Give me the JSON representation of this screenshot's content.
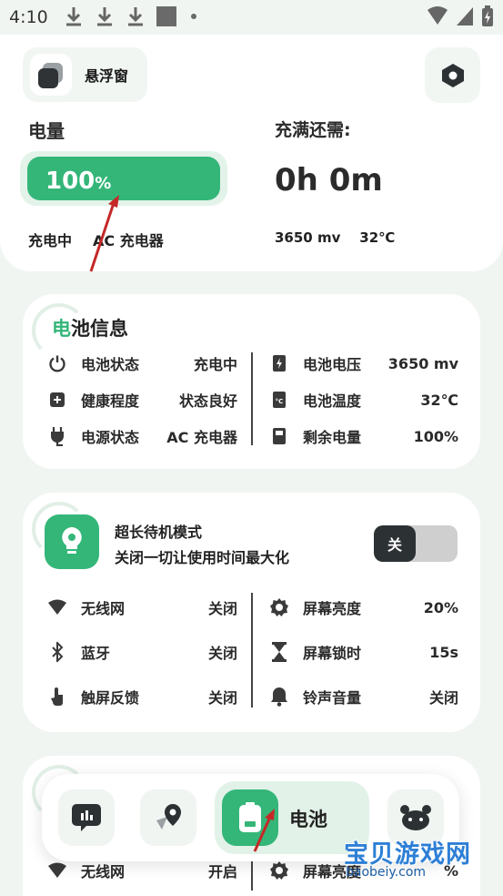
{
  "status_bar": {
    "time": "4:10"
  },
  "header": {
    "float_window_label": "悬浮窗"
  },
  "power": {
    "label": "电量",
    "percent_number": "100",
    "percent_sign": "%",
    "percent_fraction": 1.0,
    "charge_state": "充电中",
    "charger": "AC 充电器"
  },
  "full_charge": {
    "label": "充满还需:",
    "time": "0h 0m",
    "voltage_temp": "3650 mv    32℃"
  },
  "battery_info": {
    "title_accent": "电",
    "title_rest": "池信息",
    "left": [
      {
        "icon": "power-icon",
        "label": "电池状态",
        "value": "充电中"
      },
      {
        "icon": "health-plus-icon",
        "label": "健康程度",
        "value": "状态良好"
      },
      {
        "icon": "plug-icon",
        "label": "电源状态",
        "value": "AC 充电器"
      }
    ],
    "right": [
      {
        "icon": "voltage-icon",
        "label": "电池电压",
        "value": "3650 mv"
      },
      {
        "icon": "temperature-icon",
        "label": "电池温度",
        "value": "32℃"
      },
      {
        "icon": "battery-remaining-icon",
        "label": "剩余电量",
        "value": "100%"
      }
    ]
  },
  "standby_mode": {
    "title": "超长待机模式",
    "subtitle": "关闭一切让使用时间最大化",
    "toggle_label": "关",
    "left": [
      {
        "icon": "wifi-icon",
        "label": "无线网",
        "value": "关闭"
      },
      {
        "icon": "bluetooth-icon",
        "label": "蓝牙",
        "value": "关闭"
      },
      {
        "icon": "touch-icon",
        "label": "触屏反馈",
        "value": "关闭"
      }
    ],
    "right": [
      {
        "icon": "brightness-icon",
        "label": "屏幕亮度",
        "value": "20%"
      },
      {
        "icon": "hourglass-icon",
        "label": "屏幕锁时",
        "value": "15s"
      },
      {
        "icon": "bell-icon",
        "label": "铃声音量",
        "value": "关闭"
      }
    ]
  },
  "third_card": {
    "left": [
      {
        "icon": "wifi-icon",
        "label": "无线网",
        "value": "开启"
      }
    ],
    "right": [
      {
        "icon": "brightness-icon",
        "label": "屏幕亮度",
        "value": "%"
      }
    ]
  },
  "bottom_nav": {
    "active_label": "电池"
  },
  "watermark": {
    "main": "宝贝游戏网",
    "sub": "baobeiy.com"
  },
  "colors": {
    "accent": "#34b679",
    "background": "#f1f5f2",
    "dark": "#2c3133"
  }
}
